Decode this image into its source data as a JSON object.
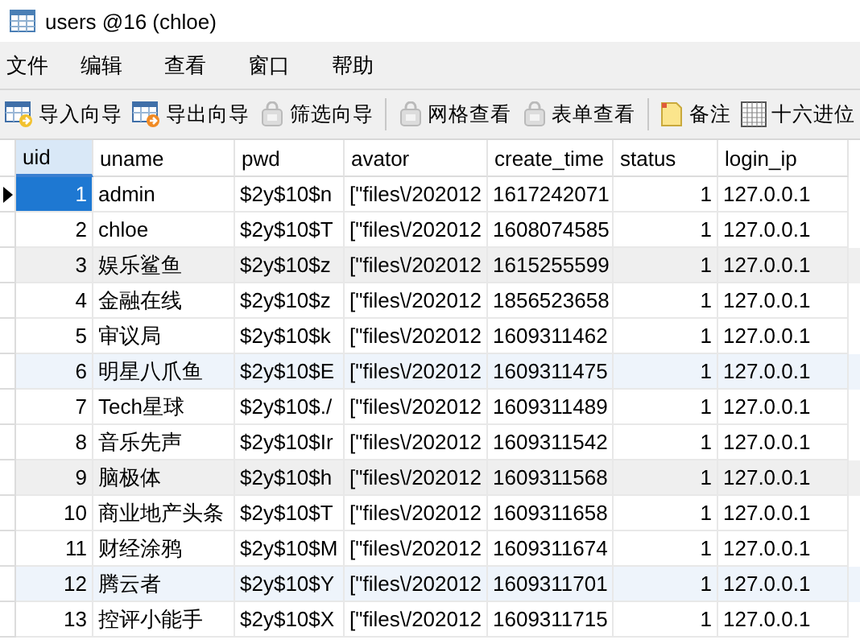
{
  "window": {
    "title": "users @16 (chloe)"
  },
  "menu": [
    "文件",
    "编辑",
    "查看",
    "窗口",
    "帮助"
  ],
  "toolbar": [
    {
      "label": "导入向导",
      "kind": "import",
      "disabled": false
    },
    {
      "label": "导出向导",
      "kind": "export",
      "disabled": false
    },
    {
      "label": "筛选向导",
      "kind": "filter",
      "disabled": true
    },
    {
      "label": "网格查看",
      "kind": "grid",
      "disabled": true
    },
    {
      "label": "表单查看",
      "kind": "form",
      "disabled": true
    },
    {
      "label": "备注",
      "kind": "note",
      "disabled": false
    },
    {
      "label": "十六进位",
      "kind": "hex",
      "disabled": false
    }
  ],
  "table": {
    "columns": [
      {
        "label": "uid",
        "selected": true
      },
      {
        "label": "uname",
        "selected": false
      },
      {
        "label": "pwd",
        "selected": false
      },
      {
        "label": "avator",
        "selected": false
      },
      {
        "label": "create_time",
        "selected": false
      },
      {
        "label": "status",
        "selected": false
      },
      {
        "label": "login_ip",
        "selected": false
      }
    ],
    "rows": [
      {
        "selected": true,
        "color": "#ffffff",
        "cells": [
          "1",
          "admin",
          "$2y$10$n",
          "[\"files\\/202012",
          "1617242071",
          "1",
          "127.0.0.1"
        ]
      },
      {
        "selected": false,
        "color": "#ffffff",
        "cells": [
          "2",
          "chloe",
          "$2y$10$T",
          "[\"files\\/202012",
          "1608074585",
          "1",
          "127.0.0.1"
        ]
      },
      {
        "selected": false,
        "color": "#efefef",
        "cells": [
          "3",
          "娱乐鲨鱼",
          "$2y$10$z",
          "[\"files\\/202012",
          "1615255599",
          "1",
          "127.0.0.1"
        ]
      },
      {
        "selected": false,
        "color": "#ffffff",
        "cells": [
          "4",
          "金融在线",
          "$2y$10$z",
          "[\"files\\/202012",
          "1856523658",
          "1",
          "127.0.0.1"
        ]
      },
      {
        "selected": false,
        "color": "#ffffff",
        "cells": [
          "5",
          "审议局",
          "$2y$10$k",
          "[\"files\\/202012",
          "1609311462",
          "1",
          "127.0.0.1"
        ]
      },
      {
        "selected": false,
        "color": "#eef4fb",
        "cells": [
          "6",
          "明星八爪鱼",
          "$2y$10$E",
          "[\"files\\/202012",
          "1609311475",
          "1",
          "127.0.0.1"
        ]
      },
      {
        "selected": false,
        "color": "#ffffff",
        "cells": [
          "7",
          "Tech星球",
          "$2y$10$./",
          "[\"files\\/202012",
          "1609311489",
          "1",
          "127.0.0.1"
        ]
      },
      {
        "selected": false,
        "color": "#ffffff",
        "cells": [
          "8",
          "音乐先声",
          "$2y$10$Ir",
          "[\"files\\/202012",
          "1609311542",
          "1",
          "127.0.0.1"
        ]
      },
      {
        "selected": false,
        "color": "#efefef",
        "cells": [
          "9",
          "脑极体",
          "$2y$10$h",
          "[\"files\\/202012",
          "1609311568",
          "1",
          "127.0.0.1"
        ]
      },
      {
        "selected": false,
        "color": "#ffffff",
        "cells": [
          "10",
          "商业地产头条",
          "$2y$10$T",
          "[\"files\\/202012",
          "1609311658",
          "1",
          "127.0.0.1"
        ]
      },
      {
        "selected": false,
        "color": "#ffffff",
        "cells": [
          "11",
          "财经涂鸦",
          "$2y$10$M",
          "[\"files\\/202012",
          "1609311674",
          "1",
          "127.0.0.1"
        ]
      },
      {
        "selected": false,
        "color": "#eef4fb",
        "cells": [
          "12",
          "腾云者",
          "$2y$10$Y",
          "[\"files\\/202012",
          "1609311701",
          "1",
          "127.0.0.1"
        ]
      },
      {
        "selected": false,
        "color": "#ffffff",
        "cells": [
          "13",
          "控评小能手",
          "$2y$10$X",
          "[\"files\\/202012",
          "1609311715",
          "1",
          "127.0.0.1"
        ]
      }
    ]
  }
}
